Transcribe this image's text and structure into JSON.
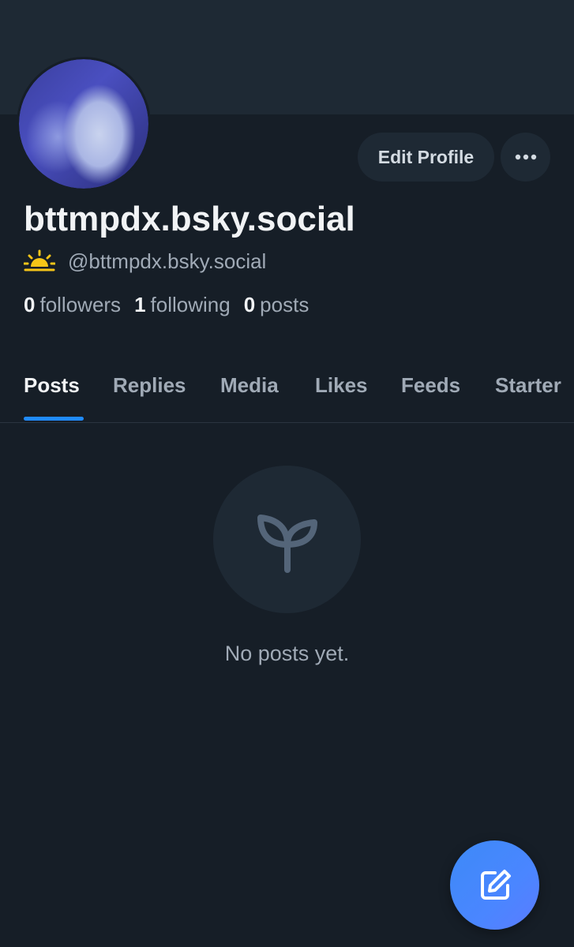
{
  "profile": {
    "display_name": "bttmpdx.bsky.social",
    "handle": "@bttmpdx.bsky.social",
    "handle_icon": "sunrise-icon",
    "edit_label": "Edit Profile",
    "more_icon": "ellipsis-icon"
  },
  "stats": {
    "followers_count": "0",
    "followers_label": "followers",
    "following_count": "1",
    "following_label": "following",
    "posts_count": "0",
    "posts_label": "posts"
  },
  "tabs": [
    {
      "label": "Posts",
      "active": true
    },
    {
      "label": "Replies",
      "active": false
    },
    {
      "label": "Media",
      "active": false
    },
    {
      "label": "Likes",
      "active": false
    },
    {
      "label": "Feeds",
      "active": false
    },
    {
      "label": "Starter",
      "active": false
    }
  ],
  "empty_state": {
    "icon": "seedling-icon",
    "text": "No posts yet."
  },
  "fab": {
    "icon": "compose-icon"
  },
  "colors": {
    "background": "#161e27",
    "banner": "#1e2934",
    "accent": "#208bfe",
    "muted_text": "#a0aab6"
  }
}
